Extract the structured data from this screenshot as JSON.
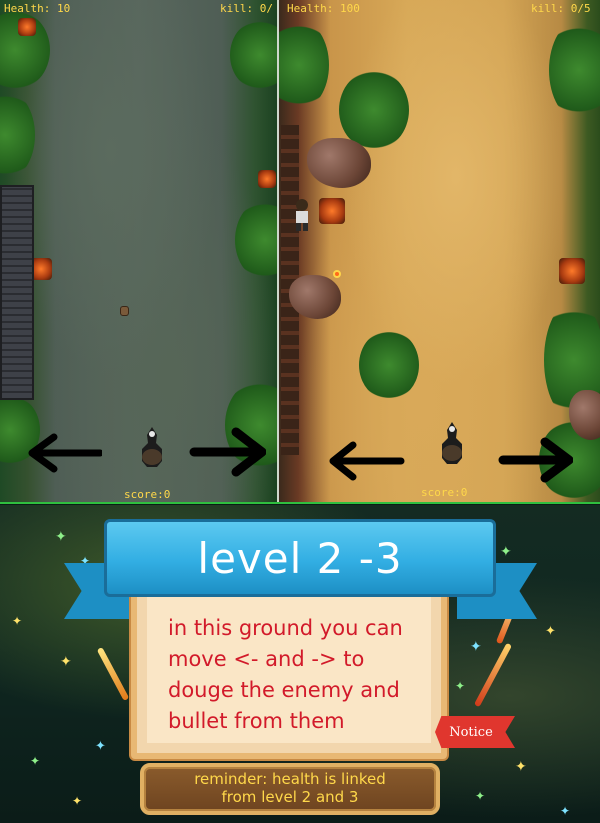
{
  "left_screen": {
    "health_text": "Health: 10",
    "kill_text": "kill: 0/",
    "score_text": "score:0"
  },
  "right_screen": {
    "health_text": "Health: 100",
    "kill_text": "kill: 0/5",
    "score_text": "score:0"
  },
  "controls": {
    "left_arrow_icon": "arrow-left",
    "right_arrow_icon": "arrow-right",
    "player_icon": "player-character"
  },
  "tutorial": {
    "level_title": "level 2 -3",
    "message": "in this ground you can\nmove <- and  -> to\ndouge the enemy and\nbullet from them",
    "reminder": "reminder: health is linked\nfrom level 2 and  3",
    "notice_label": "Notice"
  },
  "colors": {
    "hud_text": "#ffd84a",
    "message_text": "#d21a2a",
    "ribbon": "#32aee3",
    "notice_button": "#e0362e",
    "divider_green": "#2fbf3f"
  }
}
